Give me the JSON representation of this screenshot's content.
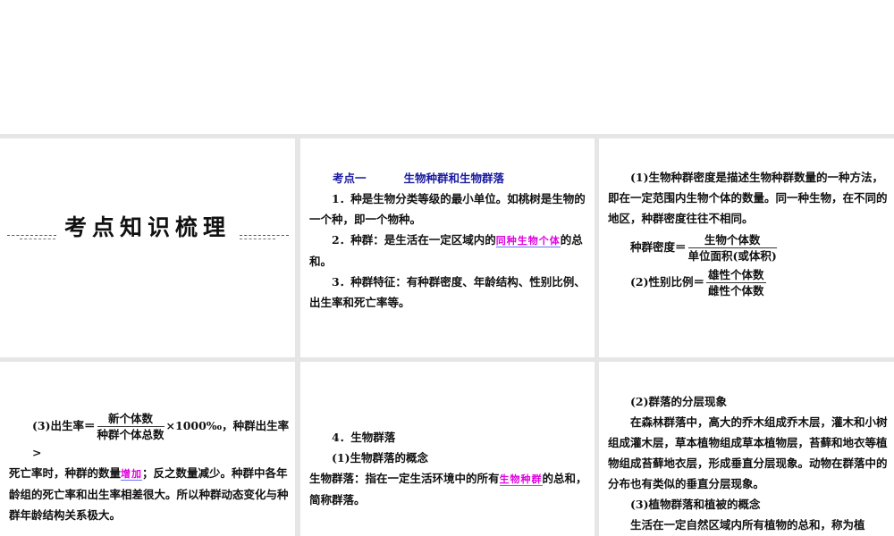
{
  "slide1": {
    "title": "考点知识梳理"
  },
  "slide2": {
    "heading_label": "考点一",
    "heading_title": "生物种群和生物群落",
    "p1": "1．种是生物分类等级的最小单位。如桃树是生物的一个种，即一个物种。",
    "p2_pre": "2．种群：是生活在一定区域内的",
    "p2_hl": "同种生物个体",
    "p2_post": "的总和。",
    "p3": "3．种群特征：有种群密度、年龄结构、性别比例、出生率和死亡率等。"
  },
  "slide3": {
    "p1": "(1)生物种群密度是描述生物种群数量的一种方法，即在一定范围内生物个体的数量。同一种生物，在不同的地区，种群密度往往不相同。",
    "density_label": "种群密度＝",
    "density_num": "生物个体数",
    "density_den": "单位面积(或体积)",
    "sex_label": "(2)性别比例＝",
    "sex_num": "雄性个体数",
    "sex_den": "雌性个体数"
  },
  "slide4": {
    "birth_label": "(3)出生率＝",
    "birth_num": "新个体数",
    "birth_den": "种群个体总数",
    "birth_post": "×1000‰，种群出生率>",
    "p_pre": "死亡率时，种群的数量",
    "p_hl": "增加",
    "p_post": "；反之数量减少。种群中各年龄组的死亡率和出生率相差很大。所以种群动态变化与种群年龄结构关系极大。"
  },
  "slide5": {
    "p1": "4．生物群落",
    "p2": "(1)生物群落的概念",
    "p3_pre": "生物群落：指在一定生活环境中的所有",
    "p3_hl": "生物种群",
    "p3_post": "的总和，简称群落。"
  },
  "slide6": {
    "p1": "(2)群落的分层现象",
    "p2": "在森林群落中，高大的乔木组成乔木层，灌木和小树组成灌木层，草本植物组成草本植物层，苔藓和地衣等植物组成苔藓地衣层，形成垂直分层现象。动物在群落中的分布也有类似的垂直分层现象。",
    "p3": "(3)植物群落和植被的概念",
    "p4": "生活在一定自然区域内所有植物的总和，称为植"
  }
}
